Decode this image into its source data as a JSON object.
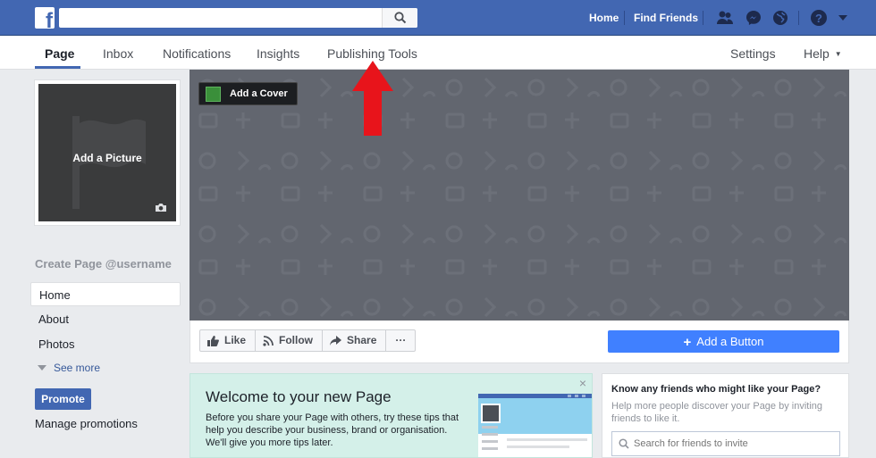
{
  "topbar": {
    "search_placeholder": "",
    "links": {
      "home": "Home",
      "find_friends": "Find Friends"
    }
  },
  "page_nav": {
    "tabs": [
      "Page",
      "Inbox",
      "Notifications",
      "Insights",
      "Publishing Tools"
    ],
    "active_tab": "Page",
    "right": {
      "settings": "Settings",
      "help": "Help"
    }
  },
  "profile": {
    "add_picture": "Add a Picture"
  },
  "sidebar": {
    "create_username": "Create Page @username",
    "items": [
      "Home",
      "About",
      "Photos"
    ],
    "see_more": "See more",
    "promote": "Promote",
    "manage_promotions": "Manage promotions"
  },
  "cover": {
    "add_cover": "Add a Cover"
  },
  "actions": {
    "like": "Like",
    "follow": "Follow",
    "share": "Share",
    "more": "···",
    "add_button": "Add a Button"
  },
  "welcome": {
    "title": "Welcome to your new Page",
    "body": "Before you share your Page with others, try these tips that help you describe your business, brand or organisation. We'll give you more tips later.",
    "close": "×"
  },
  "invite": {
    "title": "Know any friends who might like your Page?",
    "body": "Help more people discover your Page by inviting friends to like it.",
    "search_placeholder": "Search for friends to invite"
  },
  "colors": {
    "brand": "#4267b2",
    "accent": "#4080ff",
    "arrow": "#e8141b",
    "cover": "#62666f",
    "welcome_bg": "#d4f0e9"
  }
}
